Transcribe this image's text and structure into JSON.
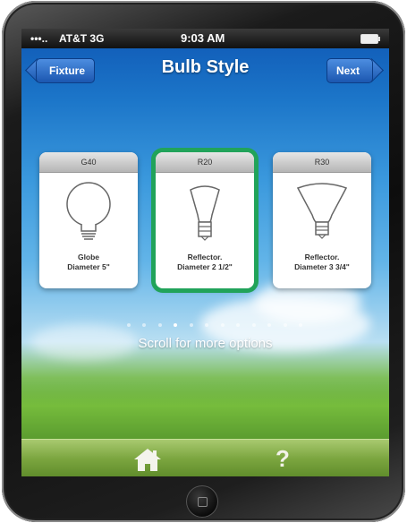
{
  "status_bar": {
    "signal": "•••..",
    "carrier": "AT&T  3G",
    "time": "9:03 AM"
  },
  "nav": {
    "title": "Bulb Style",
    "back_label": "Fixture",
    "next_label": "Next"
  },
  "bulbs": [
    {
      "code": "G40",
      "name": "Globe",
      "size": "Diameter  5\"",
      "icon": "globe-bulb-icon",
      "selected": false
    },
    {
      "code": "R20",
      "name": "Reflector.",
      "size": "Diameter  2 1/2\"",
      "icon": "reflector-bulb-icon",
      "selected": true
    },
    {
      "code": "R30",
      "name": "Reflector.",
      "size": "Diameter  3 3/4\"",
      "icon": "reflector-bulb-icon",
      "selected": false
    }
  ],
  "scroll_hint": "Scroll for more options",
  "toolbar": {
    "home_icon": "home-icon",
    "help_label": "?"
  },
  "colors": {
    "selection": "#21a35a",
    "nav_button": "#1b57b0"
  }
}
